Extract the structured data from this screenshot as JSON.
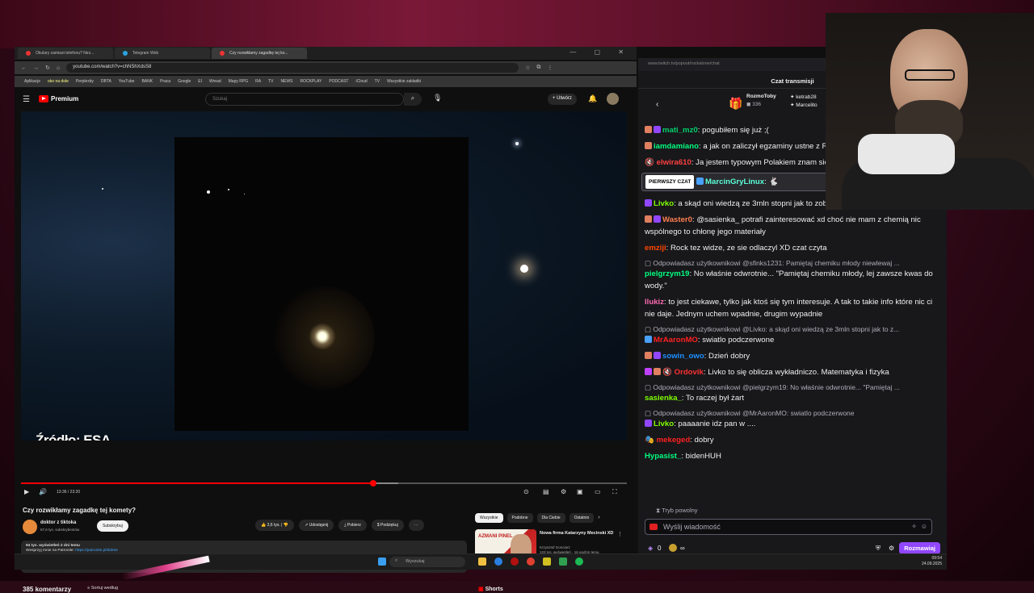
{
  "browser": {
    "tabs": [
      {
        "label": "Okulary zamiast telefonu? Nex..."
      },
      {
        "label": "Telegram Web"
      },
      {
        "label": "Czy rozwikłamy zagadkę tej ko..."
      }
    ],
    "url": "youtube.com/watch?v=chNShXdsS8",
    "bookmarks": [
      "Aplikacje",
      "oko na dole",
      "Perplexity",
      "DBTA",
      "YouTube",
      "BANK",
      "Praca",
      "Google",
      "EI",
      "Wread",
      "Mapy RPG",
      "RA",
      "TV",
      "NEWS",
      "ROCKPLAY",
      "PODCAST",
      "iCloud",
      "TV",
      "Wszystkie zakładki"
    ]
  },
  "youtube": {
    "logo": "Premium",
    "search_placeholder": "Szukaj",
    "create_label": "+ Utwórz",
    "video_overlay": "Źródło: ESA",
    "time": "13:36 / 23:20",
    "progress": 0.58,
    "title": "Czy rozwikłamy zagadkę tej komety?",
    "channel": "doktor z tiktoka",
    "subscribers": "87,6 tys. subskrybentów",
    "subscribe_label": "Subskrybuj",
    "actions": [
      "3,6 tys.",
      "Udostępnij",
      "Pobierz",
      "Podziękuj"
    ],
    "desc_stats": "94 tys. wyświetleń  2 dni temu",
    "desc_patronite": "Wesprzyj mnie na Patronite:",
    "desc_link": "https://patronite.pl/doktor",
    "desc_text": "W stronę Słońca pędzi międzygwiezdny obiekt, 3I/ATLAS, który z każdym dniem i każdym kolejnym pomiarem staje się coraz dziwniejszy. Skierowaliśmy na niego wszystkie najpotęż...",
    "desc_more": "...więcej",
    "comments_count": "385 komentarzy",
    "sort_label": "Sortuj według",
    "chips": [
      "Wszystkie",
      "Podobne",
      "Dla Ciebie",
      "Ostatnio"
    ],
    "reco": {
      "title": "Nowa firma Katarzyny Mecinski XD",
      "channel": "Krzysztof Gonciarz",
      "meta": "123 tys. wyświetleń · 16 godzin temu",
      "badge": "Nowy",
      "duration": "26:30",
      "thumb_text": "AZMANI PINEL"
    },
    "shorts_label": "Shorts"
  },
  "twitch": {
    "url": "www.twitch.tv/popout/rockalone/chat",
    "header": "Czat transmisji",
    "gift_user": "RozmoToby",
    "gift_count": "336",
    "gift_user2": "ketrab28",
    "gift_user3": "Marcelito",
    "messages": [
      {
        "user": "mati_mz0",
        "color": "#00d26a",
        "text": ": pogubiłem się już ;("
      },
      {
        "user": "iamdamiano",
        "color": "#00ff7f",
        "text": ": a jak on zaliczył egzaminy ustne z RTĘĆ ?????"
      },
      {
        "user": "elwira610",
        "color": "#ff4040",
        "text": ": Ja jestem typowym Polakiem znam się XDDDDDDD"
      },
      {
        "user": "MarcinGryLinux",
        "color": "#5cffd8",
        "text": ""
      },
      {
        "user": "Livko",
        "color": "#7fff00",
        "text": ": a skąd oni wiedzą ze 3mln stopni jak to zobaczyli XD"
      },
      {
        "user": "Waster0",
        "color": "#ff7f50",
        "text": ": @sasienka_ potrafi zainteresować xd choć nie mam z chemią nic wspólnego to chłonę jego materiały"
      },
      {
        "user": "emziji",
        "color": "#ff4500",
        "text": ": Rock tez widze, ze sie odlaczyl XD czat czyta"
      },
      {
        "user": "pielgrzym19",
        "color": "#00ff7f",
        "text": ": No właśnie odwrotnie... \"Pamiętaj chemiku młody, lej zawsze kwas do wody.\""
      },
      {
        "user": "llukiz",
        "color": "#ff69b4",
        "text": ": to jest ciekawe, tylko jak ktoś się tym interesuje. A tak to takie info które nic ci nie daje. Jednym uchem wpadnie, drugim wypadnie"
      },
      {
        "user": "MrAaronMO",
        "color": "#ff2020",
        "text": ": swiatlo podczerwone"
      },
      {
        "user": "sowin_owo",
        "color": "#1e90ff",
        "text": ": Dzień dobry"
      },
      {
        "user": "Ordovik",
        "color": "#ff3030",
        "text": ": Livko to się oblicza wykładniczo. Matematyka i fizyka"
      },
      {
        "user": "sasienka_",
        "color": "#7fff00",
        "text": ": To raczej był żart"
      },
      {
        "user": "Livko",
        "color": "#7fff00",
        "text": ": paaaanie idz pan w ...."
      },
      {
        "user": "mekeged",
        "color": "#ff2020",
        "text": ": dobry"
      },
      {
        "user": "Hypasist_",
        "color": "#00ff7f",
        "text": ": bidenHUH"
      }
    ],
    "replies": [
      "Odpowiadasz użytkownikowi @sfinks1231: Pamiętaj chemiku młody niewlewaj ...",
      "Odpowiadasz użytkownikowi @Livko: a skąd oni wiedzą ze 3mln stopni jak to z...",
      "Odpowiadasz użytkownikowi @pielgrzym19: No właśnie odwrotnie... \"Pamiętaj ...",
      "Odpowiadasz użytkownikowi @MrAaronMO: swiatlo podczerwone"
    ],
    "first_chat_label": "PIERWSZY CZAT",
    "slow_mode": "Tryb powolny",
    "input_placeholder": "Wyślij wiadomość",
    "points": "0",
    "chat_button": "Rozmawiaj"
  },
  "taskbar": {
    "search_placeholder": "Wyszukaj",
    "time": "09:54",
    "date": "24.09.2025"
  },
  "colors": {
    "youtube_red": "#ff0000",
    "twitch_purple": "#9147ff"
  }
}
